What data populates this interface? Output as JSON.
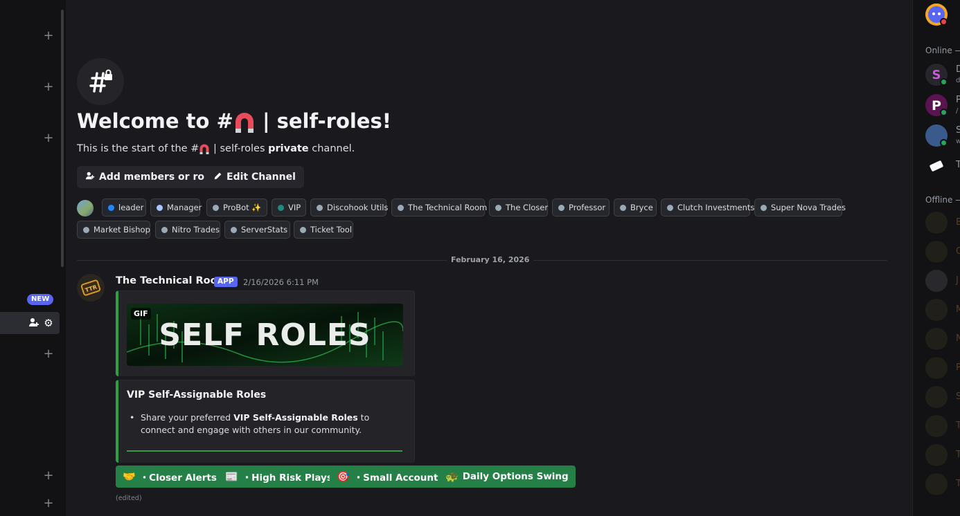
{
  "sidebar": {
    "new_badge": "NEW"
  },
  "welcome": {
    "title_prefix": "Welcome to #",
    "title_suffix": " | self-roles!",
    "sub_prefix": "This is the start of the #",
    "sub_middle": " | self-roles ",
    "sub_bold": "private",
    "sub_suffix": " channel."
  },
  "actions": {
    "add_members": "Add members or roles",
    "edit_channel": "Edit Channel"
  },
  "roles": [
    {
      "label": "leader",
      "color": "#1e88ff"
    },
    {
      "label": "Manager",
      "color": "#a7c7ff"
    },
    {
      "label": "ProBot ✨",
      "color": "#99aab5"
    },
    {
      "label": "VIP",
      "color": "#1f8b7c"
    },
    {
      "label": "Discohook Utils",
      "color": "#99aab5"
    },
    {
      "label": "The Technical Room",
      "color": "#99aab5"
    },
    {
      "label": "The Closer",
      "color": "#99aab5"
    },
    {
      "label": "Professor",
      "color": "#99aab5"
    },
    {
      "label": "Bryce",
      "color": "#99aab5"
    },
    {
      "label": "Clutch Investments",
      "color": "#99aab5"
    },
    {
      "label": "Super Nova Trades",
      "color": "#99aab5"
    },
    {
      "label": "Market Bishop",
      "color": "#99aab5"
    },
    {
      "label": "Nitro Trades",
      "color": "#99aab5"
    },
    {
      "label": "ServerStats",
      "color": "#99aab5"
    },
    {
      "label": "Ticket Tool",
      "color": "#99aab5"
    }
  ],
  "divider_date": "February 16, 2026",
  "message": {
    "author": "The Technical Room",
    "app_tag": "APP",
    "timestamp": "2/16/2026 6:11 PM",
    "gif_label": "GIF",
    "gif_text": "SELF ROLES",
    "embed_title": "VIP Self-Assignable Roles",
    "body_prefix": "Share your preferred ",
    "body_bold": "VIP Self-Assignable Roles",
    "body_suffix": " to connect and engage with others in our community.",
    "edited": "(edited)",
    "buttons": [
      {
        "emoji": "🤝",
        "label": "・Closer Alerts"
      },
      {
        "emoji": "📰",
        "label": "・High Risk Plays"
      },
      {
        "emoji": "🎯",
        "label": "・Small Account"
      },
      {
        "emoji": "🐢",
        "label": "Daily Options Swing"
      }
    ],
    "accent_color": "#2f9e44",
    "button_color": "#248046"
  },
  "members": {
    "online_header": "Online —",
    "offline_header": "Offline —",
    "online": [
      {
        "letter": "D",
        "sub": "d"
      },
      {
        "letter": "P",
        "sub": "/"
      },
      {
        "letter": "S",
        "sub": "w"
      },
      {
        "letter": "T",
        "sub": ""
      }
    ],
    "offline_letters": [
      "B",
      "C",
      "J",
      "M",
      "N",
      "P",
      "S",
      "T",
      "T",
      "T"
    ]
  }
}
